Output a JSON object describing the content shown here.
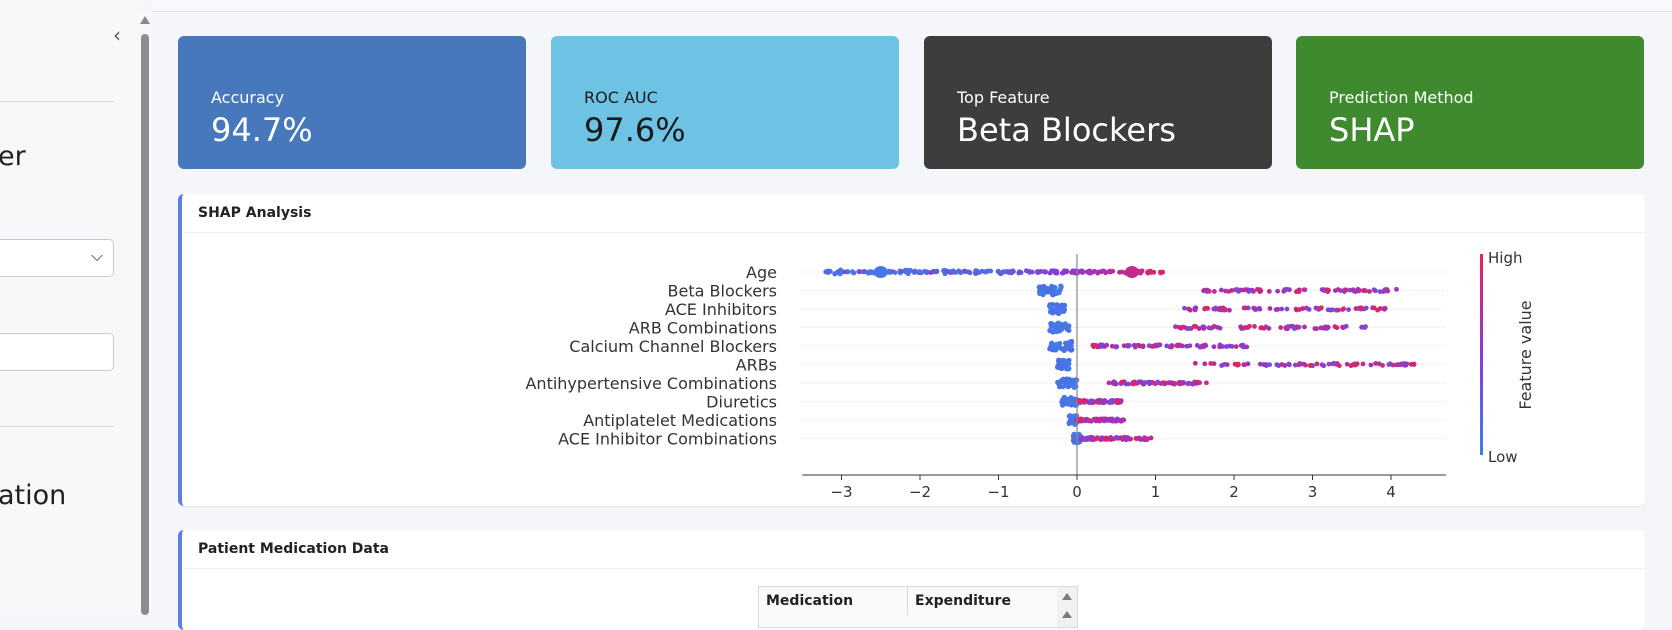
{
  "sidebar": {
    "heading_1": "er",
    "heading_2": "ation"
  },
  "cards": [
    {
      "label": "Accuracy",
      "value": "94.7%",
      "color": "#4778bc"
    },
    {
      "label": "ROC AUC",
      "value": "97.6%",
      "color": "#6ec3e4"
    },
    {
      "label": "Top Feature",
      "value": "Beta Blockers",
      "color": "#3d3d3d"
    },
    {
      "label": "Prediction Method",
      "value": "SHAP",
      "color": "#3f892f"
    }
  ],
  "shap_panel": {
    "title": "SHAP Analysis"
  },
  "data_panel": {
    "title": "Patient Medication Data",
    "table_headers": [
      "Medication",
      "Expenditure"
    ]
  },
  "chart_data": {
    "type": "scatter",
    "subtype": "shap-beeswarm",
    "features": [
      {
        "name": "Age",
        "low_range": [
          -3.2,
          -0.9
        ],
        "high_range": [
          -1.0,
          1.15
        ],
        "dense": [
          -2.5,
          0.7
        ]
      },
      {
        "name": "Beta Blockers",
        "low_range": [
          -0.5,
          -0.2
        ],
        "high_range": [
          1.6,
          4.1
        ]
      },
      {
        "name": "ACE Inhibitors",
        "low_range": [
          -0.35,
          -0.15
        ],
        "high_range": [
          1.35,
          4.0
        ]
      },
      {
        "name": "ARB Combinations",
        "low_range": [
          -0.35,
          -0.1
        ],
        "high_range": [
          1.25,
          3.7
        ]
      },
      {
        "name": "Calcium Channel Blockers",
        "low_range": [
          -0.35,
          -0.05
        ],
        "high_range": [
          0.2,
          2.2
        ]
      },
      {
        "name": "ARBs",
        "low_range": [
          -0.25,
          -0.1
        ],
        "high_range": [
          1.5,
          4.3
        ]
      },
      {
        "name": "Antihypertensive Combinations",
        "low_range": [
          -0.25,
          0.0
        ],
        "high_range": [
          0.4,
          1.65
        ]
      },
      {
        "name": "Diuretics",
        "low_range": [
          -0.2,
          0.0
        ],
        "high_range": [
          0.0,
          0.6
        ]
      },
      {
        "name": "Antiplatelet Medications",
        "low_range": [
          -0.1,
          0.0
        ],
        "high_range": [
          0.0,
          0.6
        ]
      },
      {
        "name": "ACE Inhibitor Combinations",
        "low_range": [
          -0.05,
          0.05
        ],
        "high_range": [
          0.05,
          0.95
        ]
      }
    ],
    "x_ticks": [
      -3,
      -2,
      -1,
      0,
      1,
      2,
      3,
      4
    ],
    "x_tick_labels": [
      "−3",
      "−2",
      "−1",
      "0",
      "1",
      "2",
      "3",
      "4"
    ],
    "xlim": [
      -3.5,
      4.7
    ],
    "colorbar": {
      "high_label": "High",
      "low_label": "Low",
      "title": "Feature value",
      "high_color": "#e8215a",
      "low_color": "#3d7fe8"
    }
  }
}
